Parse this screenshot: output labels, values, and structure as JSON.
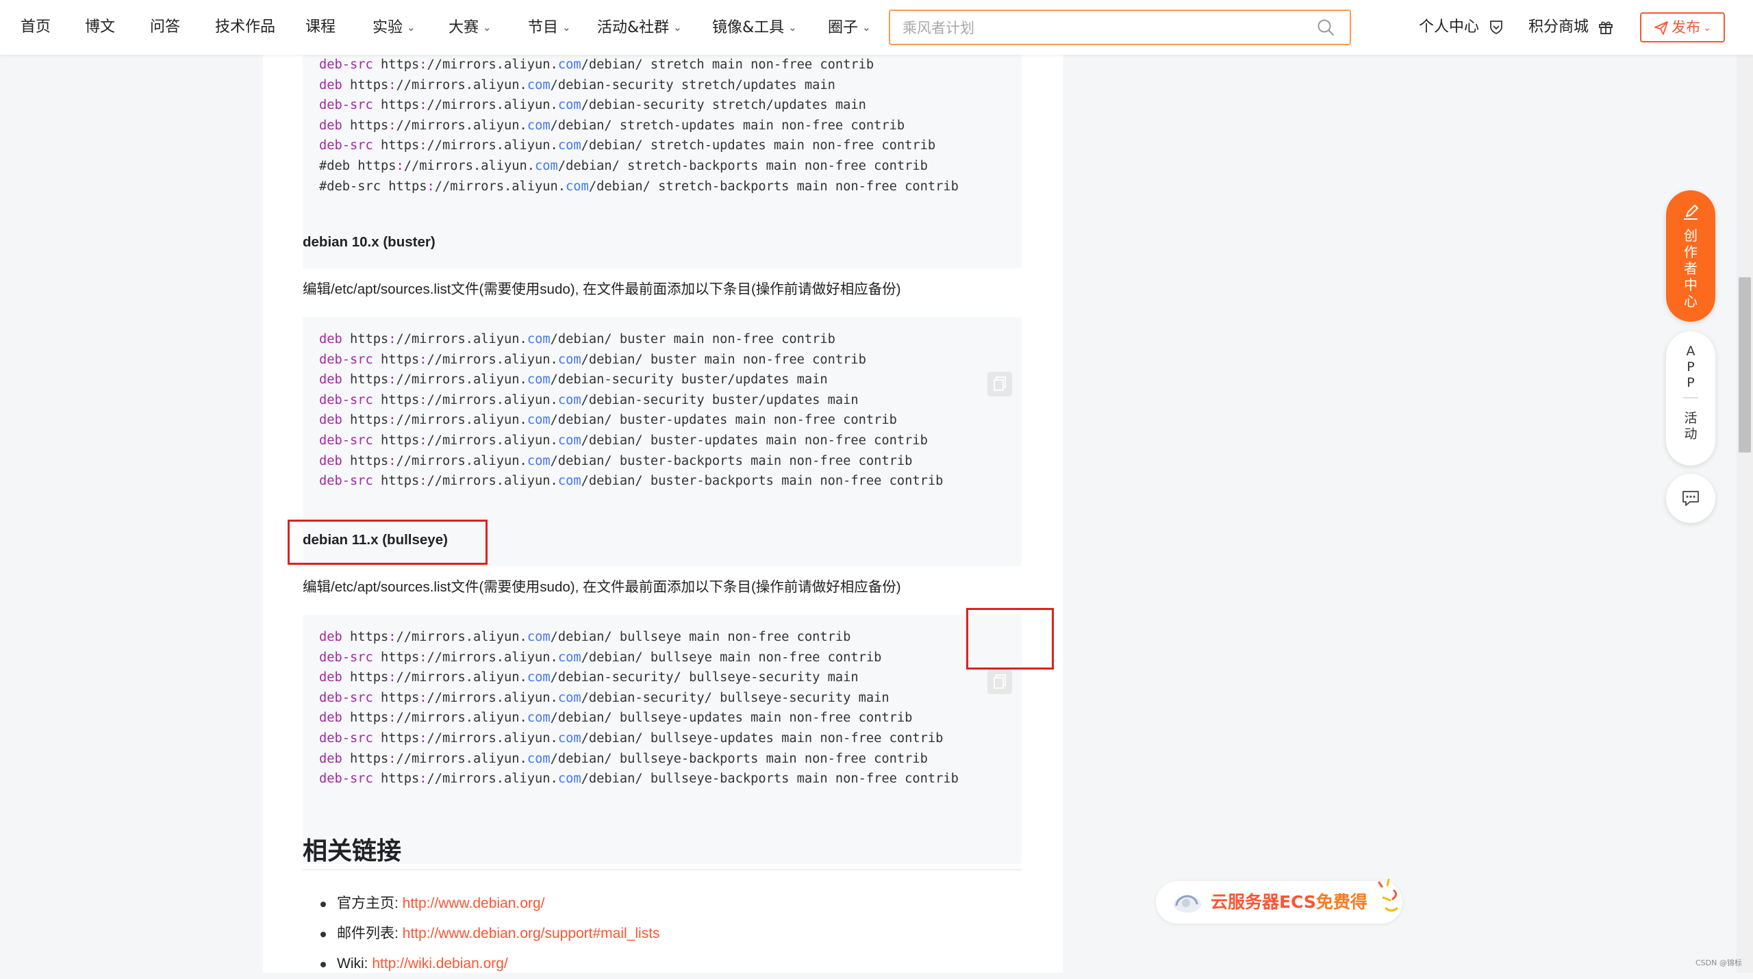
{
  "nav": {
    "items": [
      {
        "label": "首页",
        "dropdown": false
      },
      {
        "label": "博文",
        "dropdown": false
      },
      {
        "label": "问答",
        "dropdown": false
      },
      {
        "label": "技术作品",
        "dropdown": false
      },
      {
        "label": "课程",
        "dropdown": false
      },
      {
        "label": "实验",
        "dropdown": true
      },
      {
        "label": "大赛",
        "dropdown": true
      },
      {
        "label": "节目",
        "dropdown": true
      },
      {
        "label": "活动&社群",
        "dropdown": true
      },
      {
        "label": "镜像&工具",
        "dropdown": true
      },
      {
        "label": "圈子",
        "dropdown": true
      }
    ],
    "search_placeholder": "乘风者计划",
    "personal_center": "个人中心",
    "points_mall": "积分商城",
    "publish": "发布"
  },
  "article": {
    "block1_lines": [
      "deb-src https://mirrors.aliyun.com/debian/ stretch main non-free contrib",
      "deb https://mirrors.aliyun.com/debian-security stretch/updates main",
      "deb-src https://mirrors.aliyun.com/debian-security stretch/updates main",
      "deb https://mirrors.aliyun.com/debian/ stretch-updates main non-free contrib",
      "deb-src https://mirrors.aliyun.com/debian/ stretch-updates main non-free contrib",
      "#deb https://mirrors.aliyun.com/debian/ stretch-backports main non-free contrib",
      "#deb-src https://mirrors.aliyun.com/debian/ stretch-backports main non-free contrib"
    ],
    "buster_heading": "debian 10.x (buster)",
    "buster_desc": "编辑/etc/apt/sources.list文件(需要使用sudo), 在文件最前面添加以下条目(操作前请做好相应备份)",
    "block2_lines": [
      "deb https://mirrors.aliyun.com/debian/ buster main non-free contrib",
      "deb-src https://mirrors.aliyun.com/debian/ buster main non-free contrib",
      "deb https://mirrors.aliyun.com/debian-security buster/updates main",
      "deb-src https://mirrors.aliyun.com/debian-security buster/updates main",
      "deb https://mirrors.aliyun.com/debian/ buster-updates main non-free contrib",
      "deb-src https://mirrors.aliyun.com/debian/ buster-updates main non-free contrib",
      "deb https://mirrors.aliyun.com/debian/ buster-backports main non-free contrib",
      "deb-src https://mirrors.aliyun.com/debian/ buster-backports main non-free contrib"
    ],
    "bullseye_heading": "debian 11.x (bullseye)",
    "bullseye_desc": "编辑/etc/apt/sources.list文件(需要使用sudo), 在文件最前面添加以下条目(操作前请做好相应备份)",
    "block3_lines": [
      "deb https://mirrors.aliyun.com/debian/ bullseye main non-free contrib",
      "deb-src https://mirrors.aliyun.com/debian/ bullseye main non-free contrib",
      "deb https://mirrors.aliyun.com/debian-security/ bullseye-security main",
      "deb-src https://mirrors.aliyun.com/debian-security/ bullseye-security main",
      "deb https://mirrors.aliyun.com/debian/ bullseye-updates main non-free contrib",
      "deb-src https://mirrors.aliyun.com/debian/ bullseye-updates main non-free contrib",
      "deb https://mirrors.aliyun.com/debian/ bullseye-backports main non-free contrib",
      "deb-src https://mirrors.aliyun.com/debian/ bullseye-backports main non-free contrib"
    ],
    "related_heading": "相关链接",
    "links": [
      {
        "label": "官方主页:",
        "url": "http://www.debian.org/"
      },
      {
        "label": "邮件列表:",
        "url": "http://www.debian.org/support#mail_lists"
      },
      {
        "label": "Wiki:",
        "url": "http://wiki.debian.org/"
      }
    ]
  },
  "sidebar": {
    "creator_chars": [
      "创",
      "作",
      "者",
      "中",
      "心"
    ],
    "app_chars": [
      "A",
      "P",
      "P"
    ],
    "activity_chars": [
      "活",
      "动"
    ]
  },
  "ad": {
    "text_main": "云服务器ECS",
    "text_accent": "免费得"
  },
  "watermark": "CSDN @锦标",
  "colors": {
    "accent": "#fc5531",
    "search_border": "#fc9a4c",
    "code_keyword": "#a626a4",
    "code_domain": "#4078f2",
    "highlight_box": "#e02020"
  }
}
